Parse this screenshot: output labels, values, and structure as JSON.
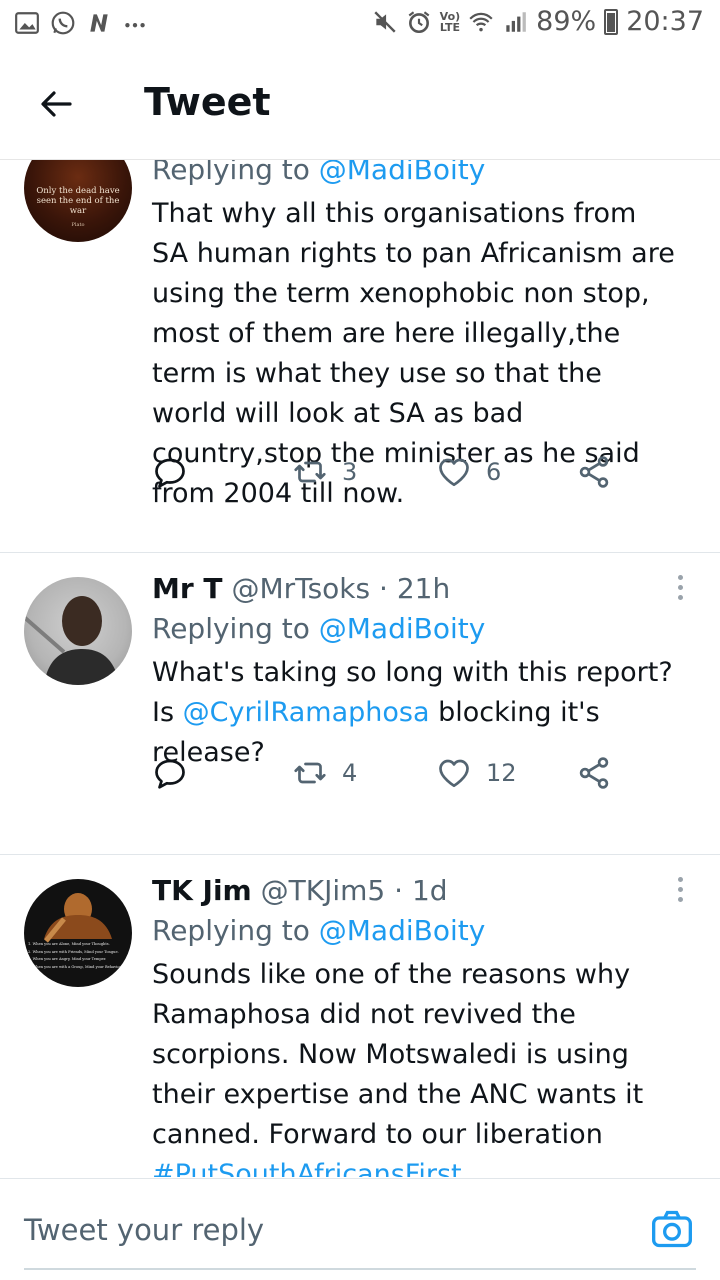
{
  "status_bar": {
    "battery": "89%",
    "time": "20:37",
    "volte": "Vo)\nLTE"
  },
  "header": {
    "title": "Tweet"
  },
  "tweets": [
    {
      "avatar_caption": "Only the dead have seen the end of the war",
      "avatar_credit": "Plato",
      "replying_prefix": "Replying to ",
      "replying_to": "@MadiBoity",
      "text": "That why all this organisations from SA human rights to pan Africanism are using the term xenophobic non stop, most of them are here illegally,the term is what they use so that  the world will look at SA as bad country,stop the minister as he said from 2004 till now.",
      "retweets": "3",
      "likes": "6"
    },
    {
      "name": "Mr T",
      "handle": "@MrTsoks",
      "time": "· 21h",
      "replying_prefix": "Replying to ",
      "replying_to": "@MadiBoity",
      "text_before": "What's taking so long with this report? Is ",
      "text_mention": "@CyrilRamaphosa",
      "text_after": " blocking it's release?",
      "retweets": "4",
      "likes": "12"
    },
    {
      "name": "TK Jim",
      "handle": "@TKJim5",
      "time": "· 1d",
      "avatar_lines": [
        "1. When you are Alone, Mind your Thoughts.",
        "2. When you are with Friends, Mind your Tongue.",
        "3. When you are Angry, Mind your Temper.",
        "4. When you are with a Group, Mind your Behaviour."
      ],
      "replying_prefix": "Replying to ",
      "replying_to": "@MadiBoity",
      "text": "Sounds like one of the reasons why Ramaphosa did not revived the scorpions. Now Motswaledi is using their expertise and the ANC wants it canned. Forward to our liberation",
      "hashtag": "#PutSouthAfricansFirst"
    }
  ],
  "reply_bar": {
    "placeholder": "Tweet your reply"
  },
  "colors": {
    "accent": "#1d9bf0",
    "secondary_text": "#536471"
  },
  "icons": [
    "gallery-icon",
    "whatsapp-icon",
    "n-app-icon",
    "more-notifications-icon",
    "mute-icon",
    "alarm-icon",
    "wifi-icon",
    "signal-icon",
    "battery-icon",
    "back-arrow-icon",
    "reply-icon",
    "retweet-icon",
    "like-icon",
    "share-icon",
    "more-options-icon",
    "camera-icon"
  ]
}
